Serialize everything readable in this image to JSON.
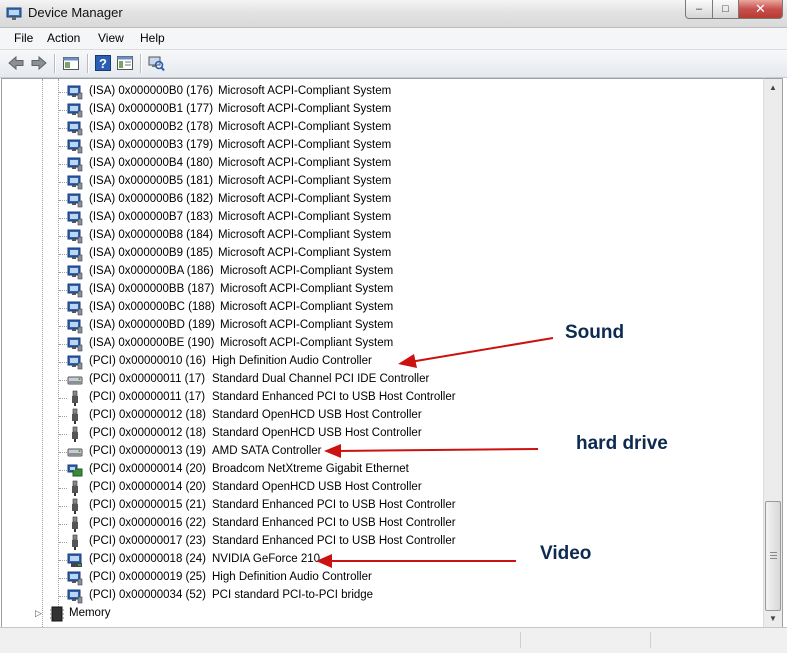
{
  "window": {
    "title": "Device Manager",
    "minimize": "–",
    "maximize": "□",
    "close": "✕"
  },
  "menu": {
    "file": "File",
    "action": "Action",
    "view": "View",
    "help": "Help"
  },
  "toolbar": {
    "back_icon": "back-arrow-icon",
    "forward_icon": "forward-arrow-icon",
    "show_hide_icon": "console-tree-icon",
    "help_icon": "help-icon",
    "properties_icon": "properties-icon",
    "scan_icon": "scan-hardware-icon"
  },
  "devices": [
    {
      "addr": "(ISA) 0x000000B0 (176)",
      "desc": "Microsoft ACPI-Compliant System",
      "icon": "monitor"
    },
    {
      "addr": "(ISA) 0x000000B1 (177)",
      "desc": "Microsoft ACPI-Compliant System",
      "icon": "monitor"
    },
    {
      "addr": "(ISA) 0x000000B2 (178)",
      "desc": "Microsoft ACPI-Compliant System",
      "icon": "monitor"
    },
    {
      "addr": "(ISA) 0x000000B3 (179)",
      "desc": "Microsoft ACPI-Compliant System",
      "icon": "monitor"
    },
    {
      "addr": "(ISA) 0x000000B4 (180)",
      "desc": "Microsoft ACPI-Compliant System",
      "icon": "monitor"
    },
    {
      "addr": "(ISA) 0x000000B5 (181)",
      "desc": "Microsoft ACPI-Compliant System",
      "icon": "monitor"
    },
    {
      "addr": "(ISA) 0x000000B6 (182)",
      "desc": "Microsoft ACPI-Compliant System",
      "icon": "monitor"
    },
    {
      "addr": "(ISA) 0x000000B7 (183)",
      "desc": "Microsoft ACPI-Compliant System",
      "icon": "monitor"
    },
    {
      "addr": "(ISA) 0x000000B8 (184)",
      "desc": "Microsoft ACPI-Compliant System",
      "icon": "monitor"
    },
    {
      "addr": "(ISA) 0x000000B9 (185)",
      "desc": "Microsoft ACPI-Compliant System",
      "icon": "monitor"
    },
    {
      "addr": "(ISA) 0x000000BA (186)",
      "desc": "Microsoft ACPI-Compliant System",
      "icon": "monitor"
    },
    {
      "addr": "(ISA) 0x000000BB (187)",
      "desc": "Microsoft ACPI-Compliant System",
      "icon": "monitor"
    },
    {
      "addr": "(ISA) 0x000000BC (188)",
      "desc": "Microsoft ACPI-Compliant System",
      "icon": "monitor"
    },
    {
      "addr": "(ISA) 0x000000BD (189)",
      "desc": "Microsoft ACPI-Compliant System",
      "icon": "monitor"
    },
    {
      "addr": "(ISA) 0x000000BE (190)",
      "desc": "Microsoft ACPI-Compliant System",
      "icon": "monitor"
    },
    {
      "addr": "(PCI) 0x00000010 (16)",
      "desc": "High Definition Audio Controller",
      "icon": "monitor"
    },
    {
      "addr": "(PCI) 0x00000011 (17)",
      "desc": "Standard Dual Channel PCI IDE Controller",
      "icon": "drive"
    },
    {
      "addr": "(PCI) 0x00000011 (17)",
      "desc": "Standard Enhanced PCI to USB Host Controller",
      "icon": "usb"
    },
    {
      "addr": "(PCI) 0x00000012 (18)",
      "desc": "Standard OpenHCD USB Host Controller",
      "icon": "usb"
    },
    {
      "addr": "(PCI) 0x00000012 (18)",
      "desc": "Standard OpenHCD USB Host Controller",
      "icon": "usb"
    },
    {
      "addr": "(PCI) 0x00000013 (19)",
      "desc": "AMD SATA Controller",
      "icon": "drive"
    },
    {
      "addr": "(PCI) 0x00000014 (20)",
      "desc": "Broadcom NetXtreme Gigabit Ethernet",
      "icon": "network"
    },
    {
      "addr": "(PCI) 0x00000014 (20)",
      "desc": "Standard OpenHCD USB Host Controller",
      "icon": "usb"
    },
    {
      "addr": "(PCI) 0x00000015 (21)",
      "desc": "Standard Enhanced PCI to USB Host Controller",
      "icon": "usb"
    },
    {
      "addr": "(PCI) 0x00000016 (22)",
      "desc": "Standard Enhanced PCI to USB Host Controller",
      "icon": "usb"
    },
    {
      "addr": "(PCI) 0x00000017 (23)",
      "desc": "Standard Enhanced PCI to USB Host Controller",
      "icon": "usb"
    },
    {
      "addr": "(PCI) 0x00000018 (24)",
      "desc": "NVIDIA GeForce 210",
      "icon": "display"
    },
    {
      "addr": "(PCI) 0x00000019 (25)",
      "desc": "High Definition Audio Controller",
      "icon": "monitor"
    },
    {
      "addr": "(PCI) 0x00000034 (52)",
      "desc": "PCI standard PCI-to-PCI bridge",
      "icon": "monitor"
    }
  ],
  "memory_node": {
    "label": "Memory",
    "icon": "memory-chip-icon"
  },
  "annotations": {
    "sound": "Sound",
    "hard_drive": "hard drive",
    "video": "Video",
    "arrow_color": "#cc1111",
    "text_color": "#0d2a50"
  }
}
